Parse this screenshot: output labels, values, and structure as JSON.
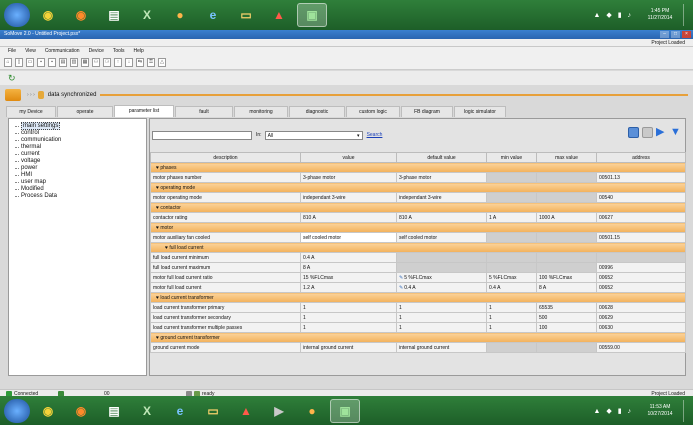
{
  "taskbar_top": {
    "apps": [
      "windows-start",
      "chrome",
      "firefox",
      "files",
      "excel",
      "solver",
      "ie",
      "folder",
      "acrobat",
      "somove"
    ],
    "time": "1:45 PM",
    "date": "11/27/2014"
  },
  "status_top": "Project Loaded",
  "window": {
    "title": "SoMove 2.0 - Untitled Project.psx*"
  },
  "menu": [
    "File",
    "View",
    "Communication",
    "Device",
    "Tools",
    "Help"
  ],
  "sync": {
    "text": "data synchronized"
  },
  "tabs": [
    "my Device",
    "operate",
    "parameter list",
    "fault",
    "monitoring",
    "diagnostic",
    "custom logic",
    "FB diagram",
    "logic simulator"
  ],
  "active_tab": "parameter list",
  "tree": [
    "main settings",
    "control",
    "communication",
    "thermal",
    "current",
    "voltage",
    "power",
    "HMI",
    "user map",
    "Modified",
    "Process Data"
  ],
  "search": {
    "in_label": "In:",
    "select_value": "All",
    "link": "Search"
  },
  "grid": {
    "columns": [
      "description",
      "value",
      "default value",
      "min value",
      "max value",
      "address"
    ],
    "rows": [
      {
        "group": "phases"
      },
      {
        "cells": [
          "motor phases number",
          "3-phase motor",
          "3-phase motor",
          "",
          "",
          "00501.13"
        ]
      },
      {
        "group": "operating mode"
      },
      {
        "cells": [
          "motor operating mode",
          "independant 3-wire",
          "independant 3-wire",
          "",
          "",
          "00540"
        ]
      },
      {
        "group": "contactor"
      },
      {
        "cells": [
          "contactor rating",
          "810 A",
          "810 A",
          "1 A",
          "1000 A",
          "00627"
        ]
      },
      {
        "group": "motor"
      },
      {
        "cells": [
          "motor auxiliary fan cooled",
          "self cooled motor",
          "self cooled motor",
          "",
          "",
          "00501.15"
        ]
      },
      {
        "group": "full load current",
        "sub": true
      },
      {
        "cells": [
          "full load current minimum",
          "0.4 A",
          "",
          "",
          "",
          ""
        ]
      },
      {
        "cells": [
          "full load current maximum",
          "8 A",
          "",
          "",
          "",
          "00996"
        ]
      },
      {
        "cells": [
          "motor full load current ratio",
          "15 %FLCmax",
          "5 %FLCmax",
          "5 %FLCmax",
          "100 %FLCmax",
          "00652"
        ]
      },
      {
        "cells": [
          "motor full load current",
          "1.2 A",
          "0.4 A",
          "0.4 A",
          "8 A",
          "00652"
        ]
      },
      {
        "group": "load current transformer"
      },
      {
        "cells": [
          "load current transformer primary",
          "1",
          "1",
          "1",
          "65535",
          "00628"
        ]
      },
      {
        "cells": [
          "load current transformer secondary",
          "1",
          "1",
          "1",
          "500",
          "00629"
        ]
      },
      {
        "cells": [
          "load current transformer multiple passes",
          "1",
          "1",
          "1",
          "100",
          "00630"
        ]
      },
      {
        "group": "ground current transformer"
      },
      {
        "cells": [
          "ground current mode",
          "internal ground current",
          "internal ground current",
          "",
          "",
          "00559.00"
        ]
      }
    ]
  },
  "statusbar": {
    "connection": "Connected",
    "count": "00",
    "state": "ready",
    "right": "Project Loaded"
  },
  "taskbar_bottom": {
    "time": "11:53 AM",
    "date": "10/27/2014"
  }
}
